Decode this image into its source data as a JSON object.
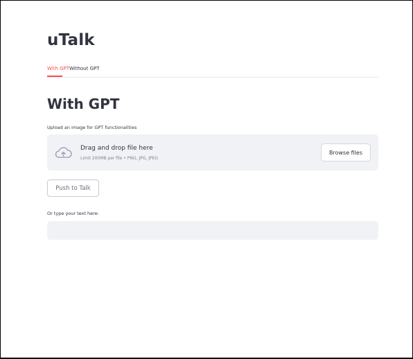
{
  "app": {
    "title": "uTalk"
  },
  "tabs": [
    {
      "label": "With GPT",
      "active": true
    },
    {
      "label": "Without GPT",
      "active": false
    }
  ],
  "section": {
    "title": "With GPT"
  },
  "uploader": {
    "label": "Upload an image for GPT functionalities",
    "drop_text": "Drag and drop file here",
    "limit_text": "Limit 200MB per file • PNG, JPG, JPEG",
    "browse_label": "Browse files",
    "icon": "cloud-upload-icon"
  },
  "push_to_talk": {
    "label": "Push to Talk"
  },
  "text_input": {
    "label": "Or type your text here:",
    "value": "",
    "placeholder": ""
  },
  "colors": {
    "accent": "#ff4b4b",
    "text": "#31333f",
    "input_bg": "#f0f2f6",
    "muted": "#808495"
  }
}
